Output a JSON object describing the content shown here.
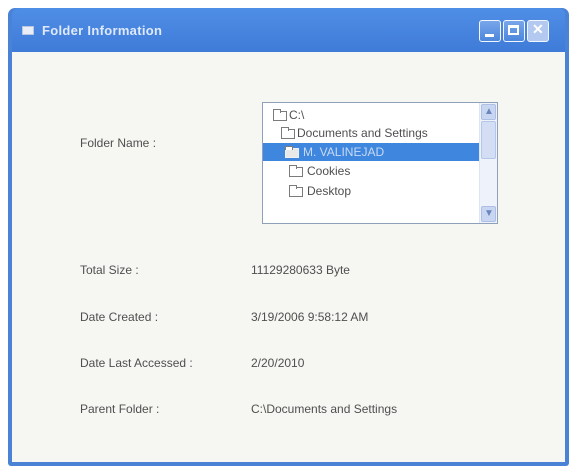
{
  "window": {
    "title": "Folder Information",
    "icon": "app-window-icon",
    "controls": [
      "minimize-icon",
      "maximize-icon",
      "close-icon"
    ],
    "colors": {
      "titlebar": "#4a82d6",
      "client": "#f6f6f3",
      "selection": "#3f86de"
    }
  },
  "fields": {
    "folder_name_label": "Folder Name :",
    "total_size_label": "Total Size :",
    "total_size_value": "11129280633 Byte",
    "date_created_label": "Date Created :",
    "date_created_value": "3/19/2006 9:58:12 AM",
    "date_accessed_label": "Date Last Accessed :",
    "date_accessed_value": "2/20/2010",
    "parent_folder_label": "Parent Folder :",
    "parent_folder_value": "C:\\Documents and Settings"
  },
  "folder_list": {
    "items": [
      {
        "label": "C:\\",
        "selected": false,
        "icon": "open-folder-icon"
      },
      {
        "label": "Documents and Settings",
        "selected": false,
        "icon": "open-folder-icon"
      },
      {
        "label": "M. VALINEJAD",
        "selected": true,
        "icon": "open-folder-icon"
      },
      {
        "label": "Cookies",
        "selected": false,
        "icon": "folder-icon"
      },
      {
        "label": "Desktop",
        "selected": false,
        "icon": "folder-icon"
      }
    ],
    "scrollbar": {
      "up_glyph": "▲",
      "down_glyph": "▼"
    }
  }
}
